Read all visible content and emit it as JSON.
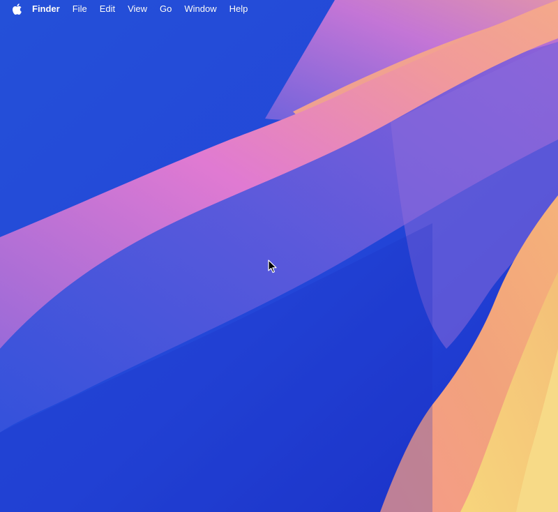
{
  "menubar": {
    "apple_icon": "apple-logo-icon",
    "app_name": "Finder",
    "items": [
      {
        "label": "File"
      },
      {
        "label": "Edit"
      },
      {
        "label": "View"
      },
      {
        "label": "Go"
      },
      {
        "label": "Window"
      },
      {
        "label": "Help"
      }
    ]
  },
  "wallpaper": {
    "colors": {
      "deep_blue": "#1a37d0",
      "blue": "#2f5be6",
      "purple": "#8a64d8",
      "pink": "#e07ad2",
      "salmon": "#f3a48a",
      "yellow": "#f6cf7a"
    }
  },
  "cursor": {
    "icon": "arrow-cursor-icon"
  }
}
